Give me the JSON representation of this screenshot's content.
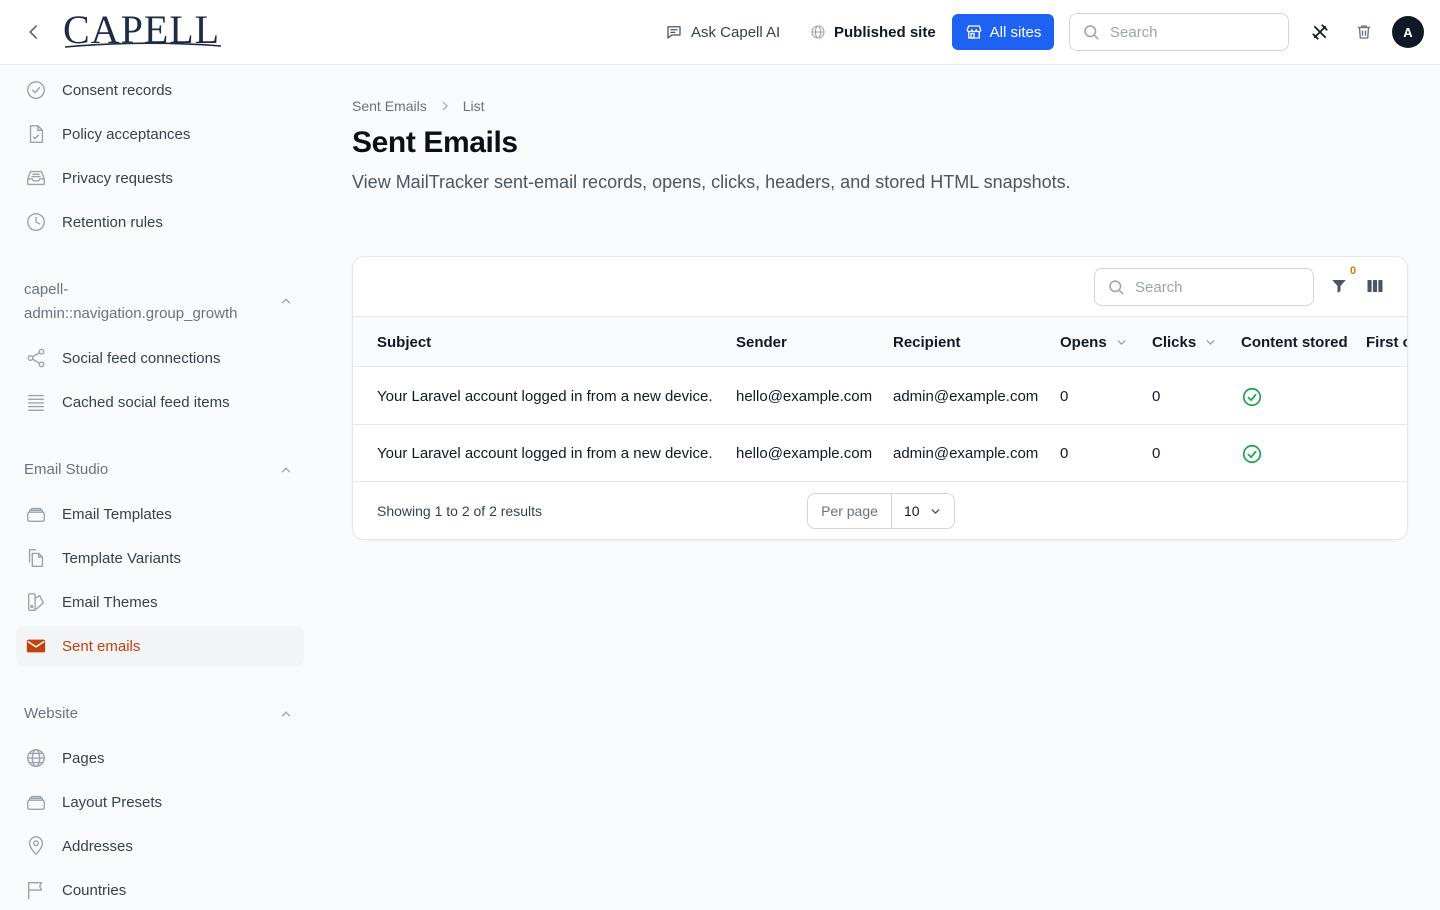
{
  "header": {
    "logo_text": "CAPELL",
    "ask_ai_label": "Ask Capell AI",
    "published_site_label": "Published site",
    "all_sites_label": "All sites",
    "search_placeholder": "Search",
    "avatar_initial": "A",
    "accent_color": "#1d62f0"
  },
  "sidebar": {
    "items_top": [
      {
        "label": "Consent records",
        "icon": "check-circle-icon"
      },
      {
        "label": "Policy acceptances",
        "icon": "document-check-icon"
      },
      {
        "label": "Privacy requests",
        "icon": "inbox-icon"
      },
      {
        "label": "Retention rules",
        "icon": "clock-icon"
      }
    ],
    "groups": [
      {
        "label": "capell-admin::navigation.group_growth",
        "items": [
          {
            "label": "Social feed connections",
            "icon": "share-icon"
          },
          {
            "label": "Cached social feed items",
            "icon": "bars-icon"
          }
        ]
      },
      {
        "label": "Email Studio",
        "items": [
          {
            "label": "Email Templates",
            "icon": "stack-icon"
          },
          {
            "label": "Template Variants",
            "icon": "documents-icon"
          },
          {
            "label": "Email Themes",
            "icon": "swatch-icon"
          },
          {
            "label": "Sent emails",
            "icon": "envelope-icon",
            "active": true
          }
        ]
      },
      {
        "label": "Website",
        "items": [
          {
            "label": "Pages",
            "icon": "globe-icon"
          },
          {
            "label": "Layout Presets",
            "icon": "stack-icon"
          },
          {
            "label": "Addresses",
            "icon": "map-pin-icon"
          },
          {
            "label": "Countries",
            "icon": "flag-icon"
          }
        ]
      }
    ],
    "active_color": "#c2410c"
  },
  "main": {
    "breadcrumb": [
      "Sent Emails",
      "List"
    ],
    "title": "Sent Emails",
    "description": "View MailTracker sent-email records, opens, clicks, headers, and stored HTML snapshots.",
    "table": {
      "search_placeholder": "Search",
      "filter_count": "0",
      "columns": [
        "Subject",
        "Sender",
        "Recipient",
        "Opens",
        "Clicks",
        "Content stored",
        "First o"
      ],
      "rows": [
        {
          "subject": "Your Laravel account logged in from a new device.",
          "sender": "hello@example.com",
          "recipient": "admin@example.com",
          "opens": "0",
          "clicks": "0",
          "content_stored": true
        },
        {
          "subject": "Your Laravel account logged in from a new device.",
          "sender": "hello@example.com",
          "recipient": "admin@example.com",
          "opens": "0",
          "clicks": "0",
          "content_stored": true
        }
      ],
      "showing_text": "Showing 1 to 2 of 2 results",
      "per_page_label": "Per page",
      "per_page_value": "10",
      "success_color": "#16a34a"
    }
  }
}
